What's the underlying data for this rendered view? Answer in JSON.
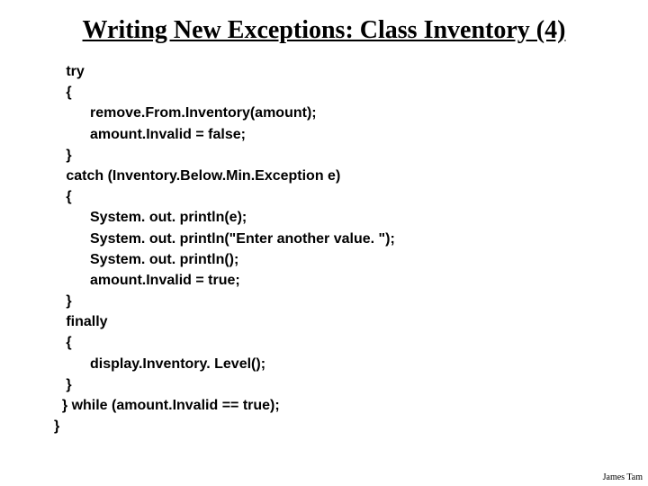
{
  "title": "Writing New Exceptions: Class Inventory (4)",
  "code": "   try\n   {\n         remove.From.Inventory(amount);\n         amount.Invalid = false;\n   }\n   catch (Inventory.Below.Min.Exception e)\n   {\n         System. out. println(e);\n         System. out. println(\"Enter another value. \");\n         System. out. println();\n         amount.Invalid = true;\n   }\n   finally\n   {\n         display.Inventory. Level();\n   }\n  } while (amount.Invalid == true);\n}",
  "footer": "James Tam"
}
